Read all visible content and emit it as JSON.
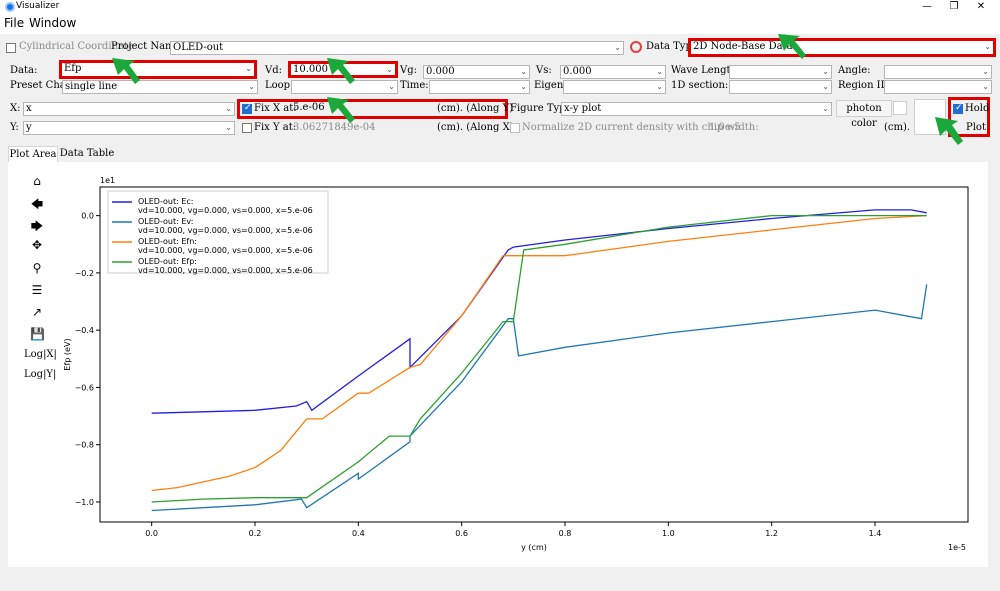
{
  "window": {
    "title": "Visualizer",
    "controls": [
      "—",
      "❐",
      "✕"
    ]
  },
  "menu": {
    "file": "File",
    "window": "Window"
  },
  "row1": {
    "cylindrical_label": "Cylindrical Coordinate",
    "project_label": "Project Name:",
    "project_value": "OLED-out",
    "datatype_label": "Data Type:",
    "datatype_value": "2D Node-Base Data"
  },
  "row2": {
    "data_label": "Data:",
    "data_value": "Efp",
    "vd_label": "Vd:",
    "vd_value": "10.000",
    "vg_label": "Vg:",
    "vg_value": "0.000",
    "vs_label": "Vs:",
    "vs_value": "0.000",
    "wavelength_label": "Wave Length:",
    "angle_label": "Angle:"
  },
  "row3": {
    "preset_label": "Preset Chart:",
    "preset_value": "single line",
    "loop_label": "Loop:",
    "time_label": "Time:",
    "eigen_label": "Eigen:",
    "section_label": "1D section:",
    "region_label": "Region ID:"
  },
  "row4": {
    "x_label": "X:",
    "x_value": "x",
    "fixx_label": "Fix X at:",
    "fixx_value": "5.e-06",
    "fixx_unit": "(cm). (Along Y)",
    "figtype_label": "Figure Type:",
    "figtype_value": "x-y plot",
    "photon_label": "photon color",
    "hold_label": "Hold"
  },
  "row5": {
    "y_label": "Y:",
    "y_value": "y",
    "fixy_label": "Fix Y at:",
    "fixy_value": "3.06271849e-04",
    "fixy_unit": "(cm). (Along X)",
    "normalize_label": "Normalize 2D current density with chip width:",
    "normalize_value": "1.0e-5",
    "cm_label": "(cm).",
    "plot_label": "Plot"
  },
  "tabs": {
    "plot_area": "Plot Area",
    "data_table": "Data Table"
  },
  "toolbar": {
    "logx": "Log|X|",
    "logy": "Log|Y|"
  },
  "chart_data": {
    "type": "line",
    "xlabel": "y (cm)",
    "ylabel": "Efp (eV)",
    "x_scale_label": "1e-5",
    "y_scale_label": "1e1",
    "xlim": [
      -0.1,
      1.58
    ],
    "ylim": [
      -1.07,
      0.1
    ],
    "x_ticks": [
      "0.0",
      "0.2",
      "0.4",
      "0.6",
      "0.8",
      "1.0",
      "1.2",
      "1.4"
    ],
    "y_ticks": [
      "0.0",
      "−0.2",
      "−0.4",
      "−0.6",
      "−0.8",
      "−1.0"
    ],
    "legend_position": "top-left",
    "series": [
      {
        "name": "OLED-out: Ec:",
        "name2": "vd=10.000, vg=0.000, vs=0.000, x=5.e-06",
        "color": "#1f1fe0",
        "x": [
          0,
          0.1,
          0.2,
          0.28,
          0.3,
          0.31,
          0.4,
          0.5,
          0.5,
          0.6,
          0.69,
          0.7,
          0.8,
          1.0,
          1.2,
          1.4,
          1.47,
          1.5
        ],
        "y": [
          -0.69,
          -0.685,
          -0.68,
          -0.665,
          -0.65,
          -0.68,
          -0.56,
          -0.43,
          -0.53,
          -0.35,
          -0.12,
          -0.11,
          -0.085,
          -0.045,
          -0.01,
          0.02,
          0.02,
          0.01
        ]
      },
      {
        "name": "OLED-out: Ev:",
        "name2": "vd=10.000, vg=0.000, vs=0.000, x=5.e-06",
        "color": "#1f77b4",
        "x": [
          0,
          0.1,
          0.2,
          0.29,
          0.3,
          0.4,
          0.4,
          0.5,
          0.5,
          0.6,
          0.69,
          0.7,
          0.71,
          0.8,
          1.0,
          1.2,
          1.4,
          1.49,
          1.5
        ],
        "y": [
          -1.03,
          -1.02,
          -1.01,
          -0.99,
          -1.02,
          -0.9,
          -0.92,
          -0.79,
          -0.77,
          -0.58,
          -0.36,
          -0.36,
          -0.49,
          -0.46,
          -0.41,
          -0.37,
          -0.33,
          -0.36,
          -0.24
        ]
      },
      {
        "name": "OLED-out: Efn:",
        "name2": "vd=10.000, vg=0.000, vs=0.000, x=5.e-06",
        "color": "#ff7f0e",
        "x": [
          0,
          0.05,
          0.1,
          0.15,
          0.2,
          0.25,
          0.3,
          0.33,
          0.4,
          0.42,
          0.5,
          0.52,
          0.6,
          0.68,
          0.72,
          0.8,
          1.0,
          1.2,
          1.4,
          1.5
        ],
        "y": [
          -0.96,
          -0.95,
          -0.93,
          -0.91,
          -0.88,
          -0.82,
          -0.71,
          -0.71,
          -0.62,
          -0.62,
          -0.53,
          -0.52,
          -0.35,
          -0.14,
          -0.14,
          -0.14,
          -0.09,
          -0.05,
          -0.01,
          0
        ]
      },
      {
        "name": "OLED-out: Efp:",
        "name2": "vd=10.000, vg=0.000, vs=0.000, x=5.e-06",
        "color": "#2ca02c",
        "x": [
          0,
          0.1,
          0.2,
          0.3,
          0.4,
          0.46,
          0.5,
          0.52,
          0.6,
          0.68,
          0.7,
          0.72,
          0.8,
          1.0,
          1.2,
          1.4,
          1.5
        ],
        "y": [
          -1.0,
          -0.99,
          -0.985,
          -0.985,
          -0.86,
          -0.77,
          -0.77,
          -0.71,
          -0.55,
          -0.37,
          -0.37,
          -0.12,
          -0.1,
          -0.04,
          0,
          0,
          0
        ]
      }
    ]
  }
}
